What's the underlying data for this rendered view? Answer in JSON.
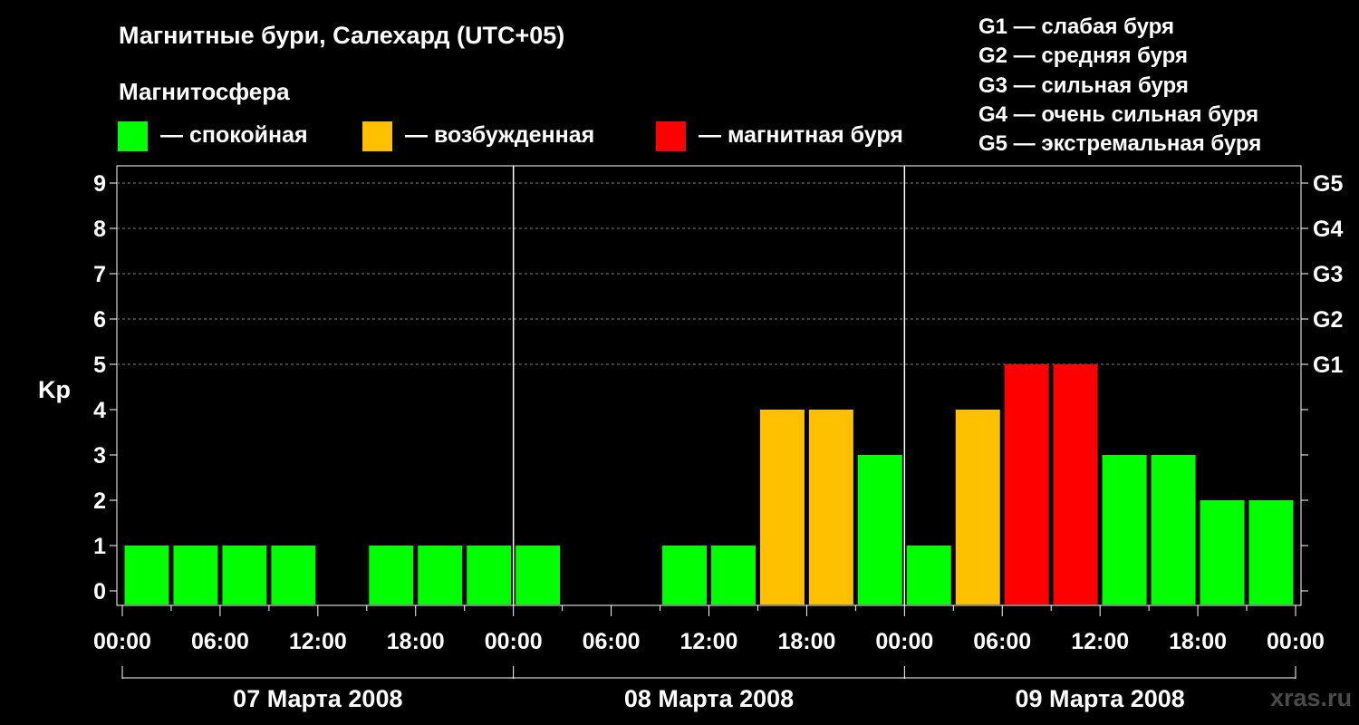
{
  "header": {
    "title": "Магнитные бури, Салехард (UTC+05)",
    "subtitle": "Магнитосфера"
  },
  "legend": [
    {
      "label": "— спокойная",
      "color": "#00ff00"
    },
    {
      "label": "— возбужденная",
      "color": "#ffc000"
    },
    {
      "label": "— магнитная буря",
      "color": "#ff0000"
    }
  ],
  "g_scale": [
    "G1 — слабая буря",
    "G2 — средняя буря",
    "G3 — сильная буря",
    "G4 — очень сильная буря",
    "G5 — экстремальная буря"
  ],
  "watermark": "xras.ru",
  "colors": {
    "quiet": "#00ff00",
    "active": "#ffc000",
    "storm": "#ff0000",
    "background": "#000000",
    "grid": "#808080"
  },
  "chart_data": {
    "type": "bar",
    "ylabel": "Kp",
    "ylim": [
      0,
      9
    ],
    "yticks": [
      "0",
      "1",
      "2",
      "3",
      "4",
      "5",
      "6",
      "7",
      "8",
      "9"
    ],
    "right_ticks": [
      {
        "value": 5,
        "label": "G1"
      },
      {
        "value": 6,
        "label": "G2"
      },
      {
        "value": 7,
        "label": "G3"
      },
      {
        "value": 8,
        "label": "G4"
      },
      {
        "value": 9,
        "label": "G5"
      }
    ],
    "grid": "dashed horizontal at 5–9",
    "xlim_hours": [
      0,
      72
    ],
    "xticks": [
      "00:00",
      "06:00",
      "12:00",
      "18:00",
      "00:00",
      "06:00",
      "12:00",
      "18:00",
      "00:00",
      "06:00",
      "12:00",
      "18:00",
      "00:00"
    ],
    "days": [
      "07 Марта 2008",
      "08 Марта 2008",
      "09 Марта 2008"
    ],
    "interval_hours": 3,
    "bar_start_hours": [
      3,
      6,
      9,
      12,
      15,
      18,
      21,
      24,
      27,
      30,
      33,
      36,
      39,
      42,
      45,
      48,
      51,
      54,
      57,
      60,
      63,
      66,
      69,
      72
    ],
    "values": [
      1,
      1,
      1,
      1,
      null,
      1,
      1,
      1,
      1,
      null,
      null,
      1,
      1,
      4,
      4,
      3,
      1,
      4,
      5,
      5,
      3,
      3,
      2,
      2
    ],
    "statuses": [
      "quiet",
      "quiet",
      "quiet",
      "quiet",
      null,
      "quiet",
      "quiet",
      "quiet",
      "quiet",
      null,
      null,
      "quiet",
      "quiet",
      "active",
      "active",
      "quiet",
      "quiet",
      "active",
      "storm",
      "storm",
      "quiet",
      "quiet",
      "quiet",
      "quiet"
    ]
  }
}
